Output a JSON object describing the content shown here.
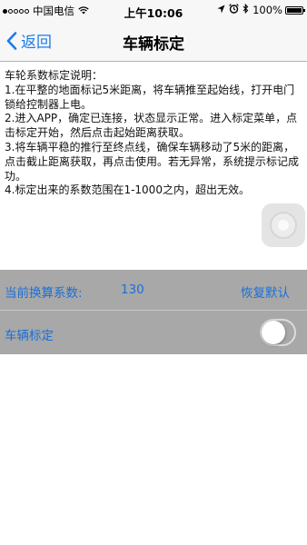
{
  "status_bar": {
    "carrier": "中国电信",
    "time": "上午10:06",
    "battery": "100%",
    "battery_level": 1.0,
    "icons": [
      "signal-dots-icon",
      "wifi-icon",
      "location-icon",
      "alarm-icon",
      "bluetooth-icon",
      "battery-icon"
    ]
  },
  "nav": {
    "back_label": "返回",
    "title": "车辆标定"
  },
  "instructions": {
    "heading": "车轮系数标定说明：",
    "steps": [
      "1.在平整的地面标记5米距离，将车辆推至起始线，打开电门锁给控制器上电。",
      "2.进入APP，确定已连接，状态显示正常。进入标定菜单，点击标定开始，然后点击起始距离获取。",
      "3.将车辆平稳的推行至终点线，确保车辆移动了5米的距离，点击截止距离获取，再点击使用。若无异常，系统提示标记成功。",
      "4.标定出来的系数范围在1-1000之内，超出无效。"
    ]
  },
  "coefficient": {
    "label": "当前换算系数:",
    "value": "130",
    "restore_label": "恢复默认"
  },
  "calibration": {
    "label": "车辆标定",
    "toggle_on": false
  },
  "colors": {
    "accent": "#1a7ce8",
    "row_background": "#a8a8a8"
  }
}
